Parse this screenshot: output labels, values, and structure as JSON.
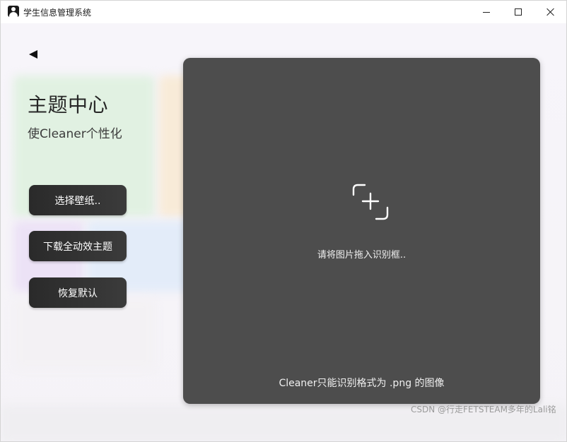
{
  "window": {
    "title": "学生信息管理系统",
    "icon": "user-app-icon",
    "controls": [
      "minimize-icon",
      "maximize-icon",
      "close-icon"
    ]
  },
  "nav": {
    "back_icon": "back-arrow-icon"
  },
  "theme_center": {
    "title": "主题中心",
    "subtitle": "使Cleaner个性化",
    "buttons": {
      "choose_wallpaper": "选择壁纸..",
      "download_theme": "下载全动效主题",
      "restore_default": "恢复默认"
    }
  },
  "drop_zone": {
    "icon": "add-image-icon",
    "hint": "请将图片拖入识别框..",
    "format_note": "Cleaner只能识别格式为 .png 的图像"
  },
  "watermark": "CSDN @行走FETSTEAM多年的Lali铭",
  "colors": {
    "panel": "#4d4d4d",
    "button": "#333333",
    "background": "#f6f5f8"
  }
}
